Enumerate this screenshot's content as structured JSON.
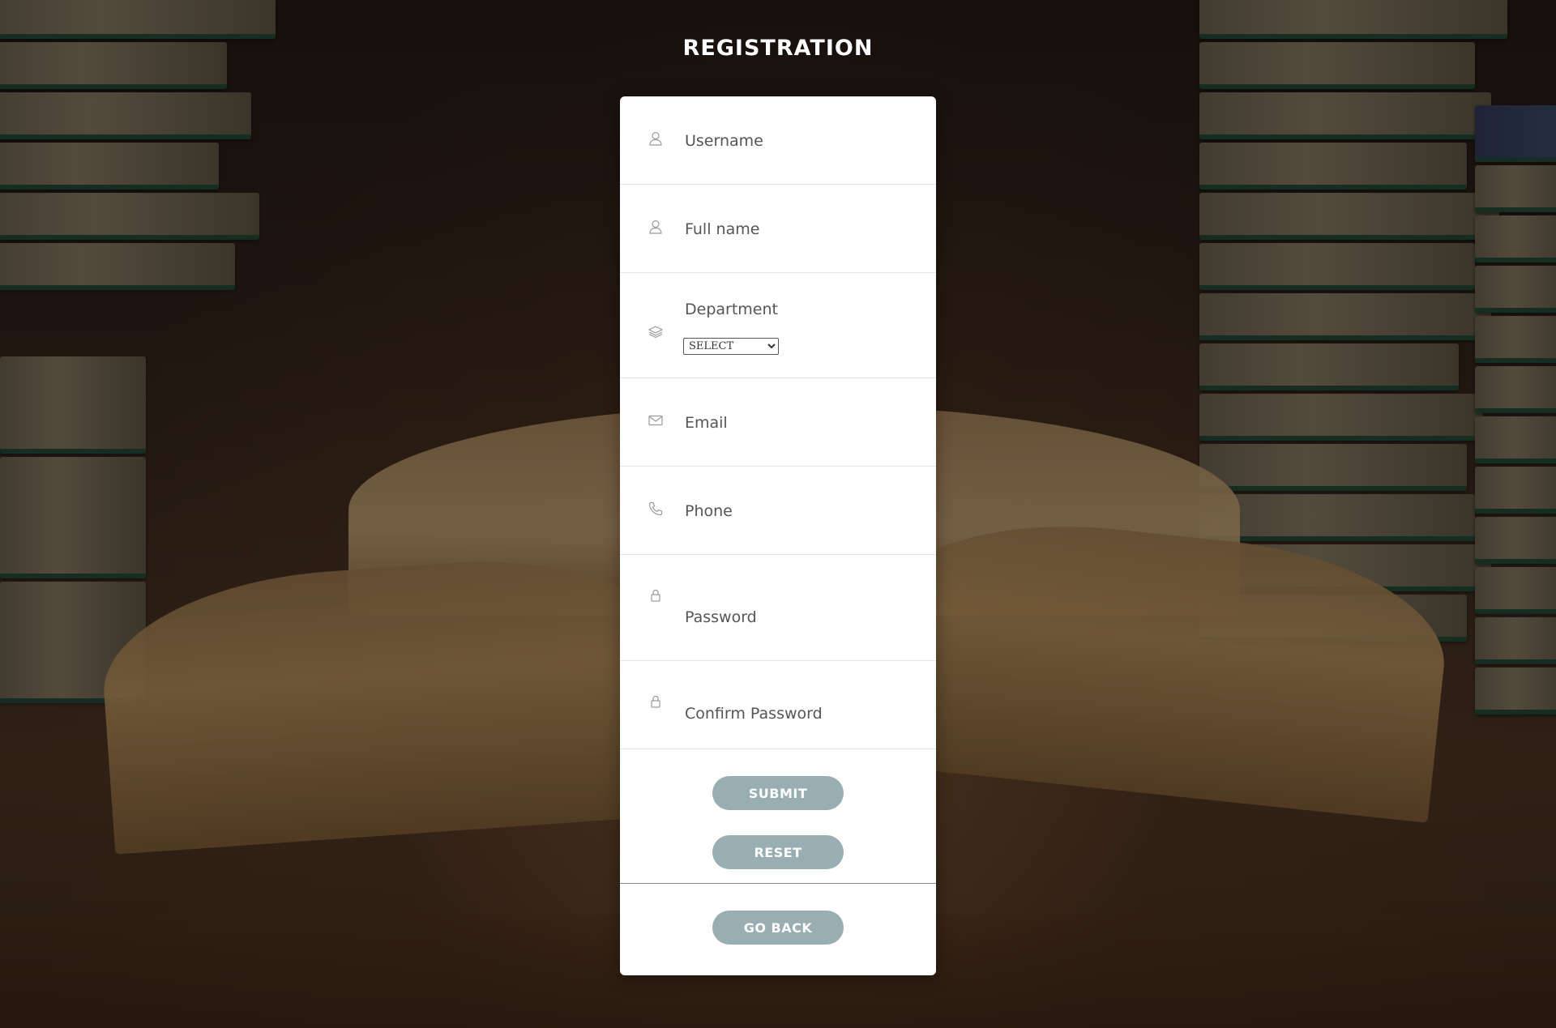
{
  "page": {
    "title": "REGISTRATION"
  },
  "form": {
    "fields": [
      {
        "name": "username",
        "placeholder": "Username",
        "icon": "user-icon"
      },
      {
        "name": "fullname",
        "placeholder": "Full name",
        "icon": "user-icon"
      },
      {
        "name": "email",
        "placeholder": "Email",
        "icon": "envelope-icon"
      },
      {
        "name": "phone",
        "placeholder": "Phone",
        "icon": "phone-icon"
      },
      {
        "name": "password",
        "placeholder": "Password",
        "icon": "lock-icon"
      },
      {
        "name": "confirm_password",
        "placeholder": "Confirm Password",
        "icon": "lock-icon"
      }
    ],
    "department": {
      "label": "Department",
      "icon": "layers-icon",
      "selected": "SELECT",
      "options": [
        "SELECT"
      ]
    },
    "buttons": {
      "submit": "SUBMIT",
      "reset": "RESET",
      "back": "GO BACK"
    }
  },
  "colors": {
    "button_bg": "#99aeb2",
    "card_bg": "#ffffff",
    "title_text": "#ffffff",
    "field_text": "#555555"
  }
}
